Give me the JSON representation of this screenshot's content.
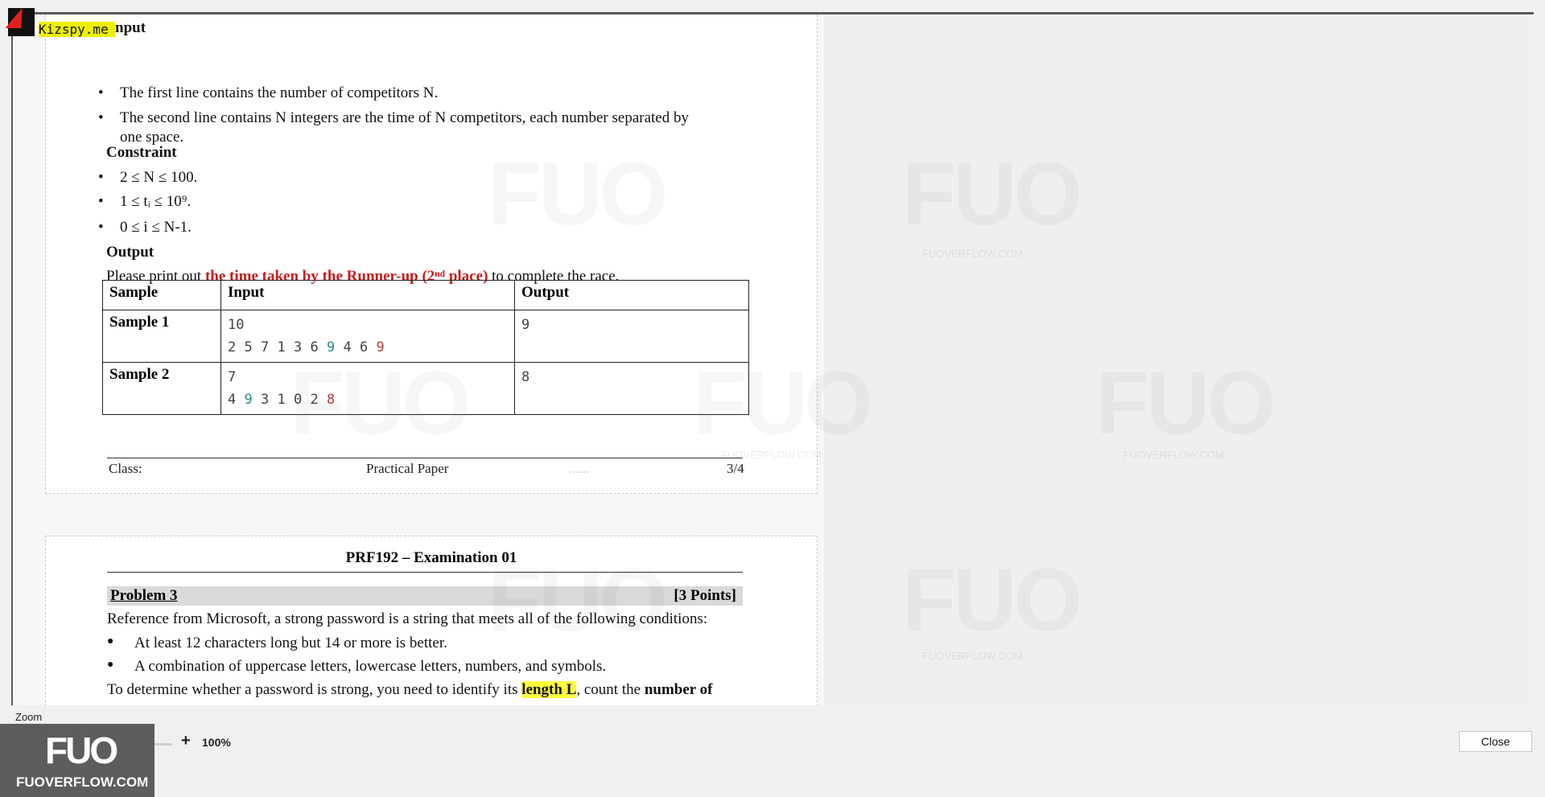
{
  "page1": {
    "input_heading_tail": "nput",
    "input_bullets": [
      "The first line contains the number of competitors N.",
      "The second line contains N integers are the time of N competitors, each number separated by",
      "one space."
    ],
    "constraint_heading": "Constraint",
    "constraints": [
      "2 ≤ N ≤ 100.",
      "1 ≤ tᵢ ≤ 10⁹.",
      "0 ≤ i ≤ N-1."
    ],
    "output_heading": "Output",
    "output_prefix": "Please print out",
    "output_highlight": "the time taken by the Runner-up (2ⁿᵈ place)",
    "output_suffix": "to complete the race.",
    "table": {
      "headers": [
        "Sample",
        "Input",
        "Output"
      ],
      "rows": [
        {
          "sample": "Sample 1",
          "input_line1": "10",
          "input_line2": [
            "2",
            "5",
            "7",
            "1",
            "3",
            "6",
            "9",
            "4",
            "6",
            "9"
          ],
          "output": "9"
        },
        {
          "sample": "Sample 2",
          "input_line1": "7",
          "input_line2": [
            "4",
            "9",
            "3",
            "1",
            "0",
            "2",
            "8"
          ],
          "output": "8"
        }
      ]
    },
    "footer": {
      "class_label": "Class:",
      "center": "Practical Paper",
      "dots": "......",
      "page": "3/4"
    }
  },
  "page2": {
    "exam_title": "PRF192 – Examination 01",
    "problem_title": "Problem 3",
    "points": "[3 Points]",
    "intro": "Reference from Microsoft, a strong password is a string that meets all of the following conditions:",
    "conditions": [
      "At least 12 characters long but 14 or more is better.",
      "A combination of uppercase letters, lowercase letters, numbers, and symbols."
    ],
    "line_start": "To determine whether a password is strong, you need to identify its",
    "line_hl": "length L",
    "line_mid": ", count the",
    "line_bold": "number of"
  },
  "overlay": {
    "k_badge": "Kizspy.me",
    "watermark_logo": "FUO",
    "watermark_site": "FUOVERFLOW.COM"
  },
  "controls": {
    "zoom_label": "Zoom",
    "zoom_minus": "-",
    "zoom_plus": "+",
    "zoom_value": "100%",
    "close_label": "Close"
  }
}
